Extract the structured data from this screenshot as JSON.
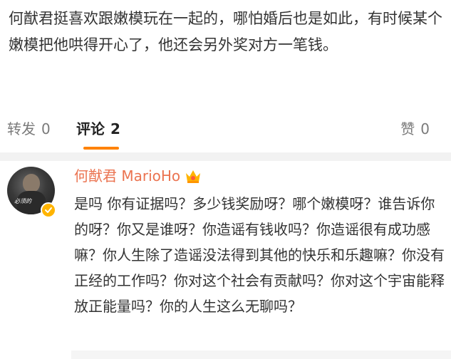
{
  "post": {
    "text": "何猷君挺喜欢跟嫩模玩在一起的，哪怕婚后也是如此，有时候某个嫩模把他哄得开心了，他还会另外奖对方一笔钱。"
  },
  "tabs": {
    "repost_label": "转发",
    "repost_count": "0",
    "comments_label": "评论",
    "comments_count": "2",
    "likes_label": "赞",
    "likes_count": "0"
  },
  "comment": {
    "author": "何猷君 MarioHo",
    "avatar_watermark": "必须的",
    "body": "是吗 你有证据吗？多少钱奖励呀？哪个嫩模呀？谁告诉你的呀？你又是谁呀？你造谣有钱收吗？你造谣很有成功感嘛？你人生除了造谣没法得到其他的快乐和乐趣嘛？你没有正经的工作吗？你对这个社会有贡献吗？你对这个宇宙能释放正能量吗？你的人生这么无聊吗？"
  },
  "colors": {
    "accent": "#ff8200",
    "author_name": "#eb7350",
    "badge": "#ffb400"
  },
  "icons": {
    "verified": "verified-badge-icon",
    "vip_crown": "crown-icon"
  }
}
